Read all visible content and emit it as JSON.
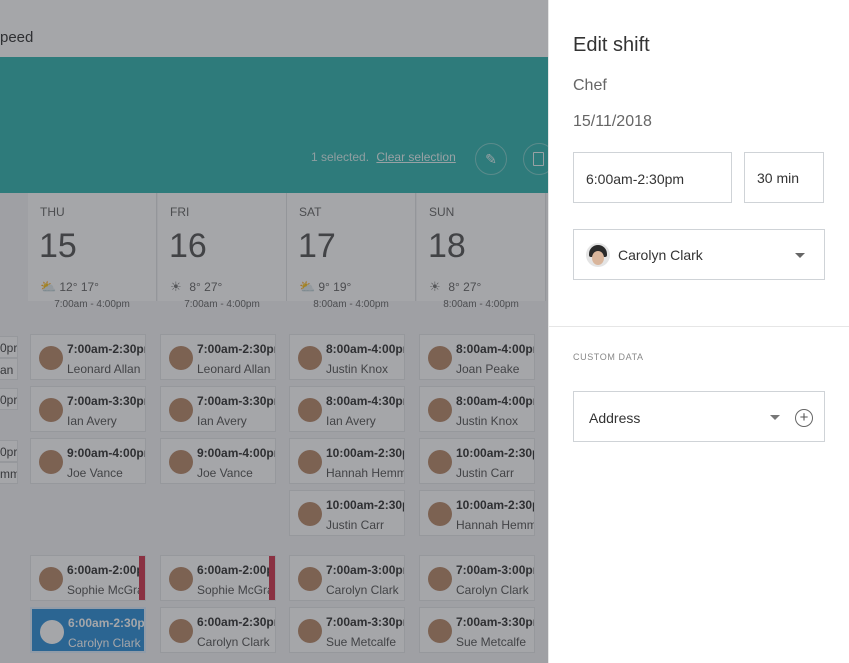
{
  "background": {
    "crumb": "peed",
    "selection_text": "1 selected.",
    "clear_selection": "Clear selection",
    "left_fragments": [
      "0pr",
      "an",
      "0pr",
      "0pr",
      "mm"
    ],
    "days": [
      {
        "dow": "THU",
        "num": "15",
        "weather_icon": "cloud-sun-icon",
        "temps": "12° 17°",
        "header_hours": "7:00am - 4:00pm",
        "shifts": [
          {
            "time": "7:00am-2:30pr",
            "name": "Leonard Allan"
          },
          {
            "time": "7:00am-3:30pr",
            "name": "Ian Avery"
          },
          {
            "time": "9:00am-4:00pr",
            "name": "Joe Vance"
          },
          null,
          {
            "time": "6:00am-2:00pr",
            "name": "Sophie McGra"
          },
          {
            "time": "6:00am-2:30pr",
            "name": "Carolyn Clark"
          }
        ]
      },
      {
        "dow": "FRI",
        "num": "16",
        "weather_icon": "sun-icon",
        "temps": "8° 27°",
        "header_hours": "7:00am - 4:00pm",
        "shifts": [
          {
            "time": "7:00am-2:30pr",
            "name": "Leonard Allan"
          },
          {
            "time": "7:00am-3:30pr",
            "name": "Ian Avery"
          },
          {
            "time": "9:00am-4:00pr",
            "name": "Joe Vance"
          },
          null,
          {
            "time": "6:00am-2:00pr",
            "name": "Sophie McGrat"
          },
          {
            "time": "6:00am-2:30pr",
            "name": "Carolyn Clark"
          }
        ]
      },
      {
        "dow": "SAT",
        "num": "17",
        "weather_icon": "cloud-sun-icon",
        "temps": "9° 19°",
        "header_hours": "8:00am - 4:00pm",
        "shifts": [
          {
            "time": "8:00am-4:00pr",
            "name": "Justin Knox"
          },
          {
            "time": "8:00am-4:30pr",
            "name": "Ian Avery"
          },
          {
            "time": "10:00am-2:30p",
            "name": "Hannah Hemm"
          },
          {
            "time": "10:00am-2:30p",
            "name": "Justin Carr"
          },
          {
            "time": "7:00am-3:00pr",
            "name": "Carolyn Clark"
          },
          {
            "time": "7:00am-3:30pr",
            "name": "Sue Metcalfe"
          }
        ]
      },
      {
        "dow": "SUN",
        "num": "18",
        "weather_icon": "sun-icon",
        "temps": "8° 27°",
        "header_hours": "8:00am - 4:00pm",
        "shifts": [
          {
            "time": "8:00am-4:00pr",
            "name": "Joan Peake"
          },
          {
            "time": "8:00am-4:00pr",
            "name": "Justin Knox"
          },
          {
            "time": "10:00am-2:30p",
            "name": "Justin Carr"
          },
          {
            "time": "10:00am-2:30p",
            "name": "Hannah Hemm"
          },
          {
            "time": "7:00am-3:00pr",
            "name": "Carolyn Clark"
          },
          {
            "time": "7:00am-3:30pr",
            "name": "Sue Metcalfe"
          }
        ]
      }
    ]
  },
  "panel": {
    "title": "Edit shift",
    "role": "Chef",
    "date": "15/11/2018",
    "time_value": "6:00am-2:30pm",
    "break_value": "30 min",
    "employee": "Carolyn Clark",
    "section_label": "CUSTOM DATA",
    "address_label": "Address"
  }
}
